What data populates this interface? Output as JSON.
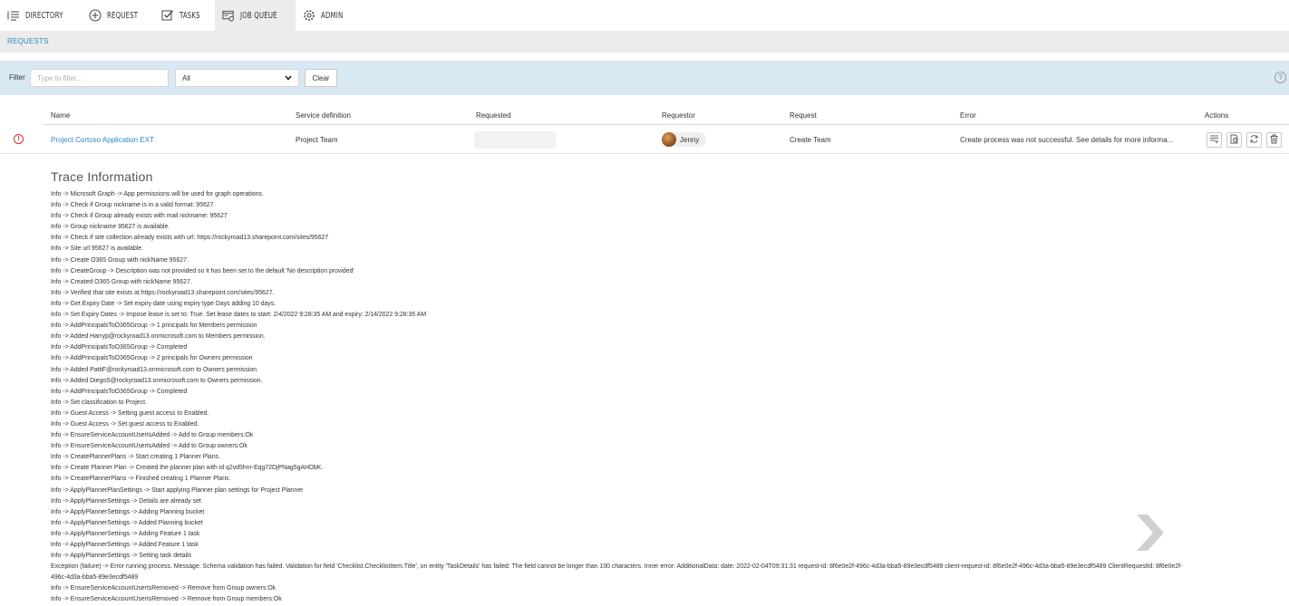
{
  "nav": {
    "items": [
      {
        "label": "Directory",
        "icon": "list-icon",
        "active": false
      },
      {
        "label": "Request",
        "icon": "plus-circle-icon",
        "active": false
      },
      {
        "label": "Tasks",
        "icon": "checkbox-icon",
        "active": false
      },
      {
        "label": "Job Queue",
        "icon": "job-queue-icon",
        "active": true
      },
      {
        "label": "Admin",
        "icon": "gear-icon",
        "active": false
      }
    ]
  },
  "breadcrumb": "REQUESTS",
  "filter": {
    "label": "Filter",
    "placeholder": "Type to filter...",
    "select_value": "All",
    "clear_label": "Clear",
    "help": "?"
  },
  "table": {
    "headers": {
      "name": "Name",
      "service": "Service definition",
      "requested": "Requested",
      "requestor": "Requestor",
      "request": "Request",
      "error": "Error",
      "actions": "Actions"
    },
    "row": {
      "name": "Project Cortoso Application EXT",
      "service": "Project Team",
      "requested": "",
      "requestor": "Jenny",
      "request": "Create Team",
      "error": "Create process was not successful. See details for more informa..."
    }
  },
  "trace": {
    "title": "Trace Information",
    "lines": [
      "Info -> Microsoft Graph -> App permissions will be used for graph operations.",
      "Info -> Check if Group nickname is in a valid format: 95627",
      "Info -> Check if Group already exists with mail nickname: 95627",
      "Info -> Group nickname 95627 is available.",
      "Info -> Check if site collection already exists with url: https://rockyroad13.sharepoint.com/sites/95627",
      "Info -> Site url 95627 is available.",
      "Info -> Create O365 Group with nickName 95627.",
      "Info -> CreateGroup -> Description was not provided so it has been set to the default 'No description provided'",
      "Info -> Created O365 Group with nickName 95627.",
      "Info -> Verified that site exists at https://rockyroad13.sharepoint.com/sites/95627.",
      "Info -> Get Expiry Date -> Set expiry date using expiry type Days adding 10 days.",
      "Info -> Set Expiry Dates -> Impose lease is set to: True. Set lease dates to start: 2/4/2022 9:28:35 AM and expiry: 2/14/2022 9:28:35 AM",
      "Info -> AddPrincipalsToO365Group -> 1 principals for Members permission",
      "Info -> Added Harryp@rockyroad13.onmicrosoft.com to Members permission.",
      "Info -> AddPrincipalsToO365Group -> Completed",
      "Info -> AddPrincipalsToO365Group -> 2 principals for Owners permission",
      "Info -> Added PattiF@rockyroad13.onmicrosoft.com to Owners permission.",
      "Info -> Added DiegoS@rockyroad13.onmicrosoft.com to Owners permission.",
      "Info -> AddPrincipalsToO365Group -> Completed",
      "Info -> Set classification to Project.",
      "Info -> Guest Access -> Setting guest access to Enabled.",
      "Info -> Guest Access -> Set guest access to Enabled.",
      "Info -> EnsureServiceAccountUserIsAdded -> Add to Group members:Ok",
      "Info -> EnsureServiceAccountUserIsAdded -> Add to Group owners:Ok",
      "Info -> CreatePlannerPlans -> Start creating 1 Planner Plans.",
      "Info -> Create Planner Plan -> Created the planner plan with id q2vd5hnr-Eqg72DjPNag5gAHDbK.",
      "Info -> CreatePlannerPlans -> Finished creating 1 Planner Plans.",
      "Info -> ApplyPlannerPlanSettings -> Start applying Planner plan settings for Project Planner",
      "Info -> ApplyPlannerSettings -> Details are already set",
      "Info -> ApplyPlannerSettings -> Adding Planning bucket",
      "Info -> ApplyPlannerSettings -> Added Planning bucket",
      "Info -> ApplyPlannerSettings -> Adding Feature 1 task",
      "Info -> ApplyPlannerSettings -> Added Feature 1 task",
      "Info -> ApplyPlannerSettings -> Setting task details",
      "Exception (failure) -> Error running process. Message: Schema validation has failed. Validation for field 'Checklist.ChecklistItem.Title', on entity 'TaskDetails' has failed: The field cannot be longer than 100 characters. Inner error: AdditionalData: date: 2022-02-04T09:31:31 request-id: 8f6e0e2f-496c-4d3a-bba5-89e3ecdf5489 client-request-id: 8f6e0e2f-496c-4d3a-bba5-89e3ecdf5489 ClientRequestId: 8f6e0e2f-496c-4d3a-bba5-89e3ecdf5489",
      "Info -> EnsureServiceAccountUserIsRemoved -> Remove from Group owners:Ok",
      "Info -> EnsureServiceAccountUserIsRemoved -> Remove from Group members:Ok"
    ]
  },
  "colors": {
    "accent": "#2e86c1",
    "filter_bg": "#d9e9f4",
    "error": "#d93025"
  }
}
